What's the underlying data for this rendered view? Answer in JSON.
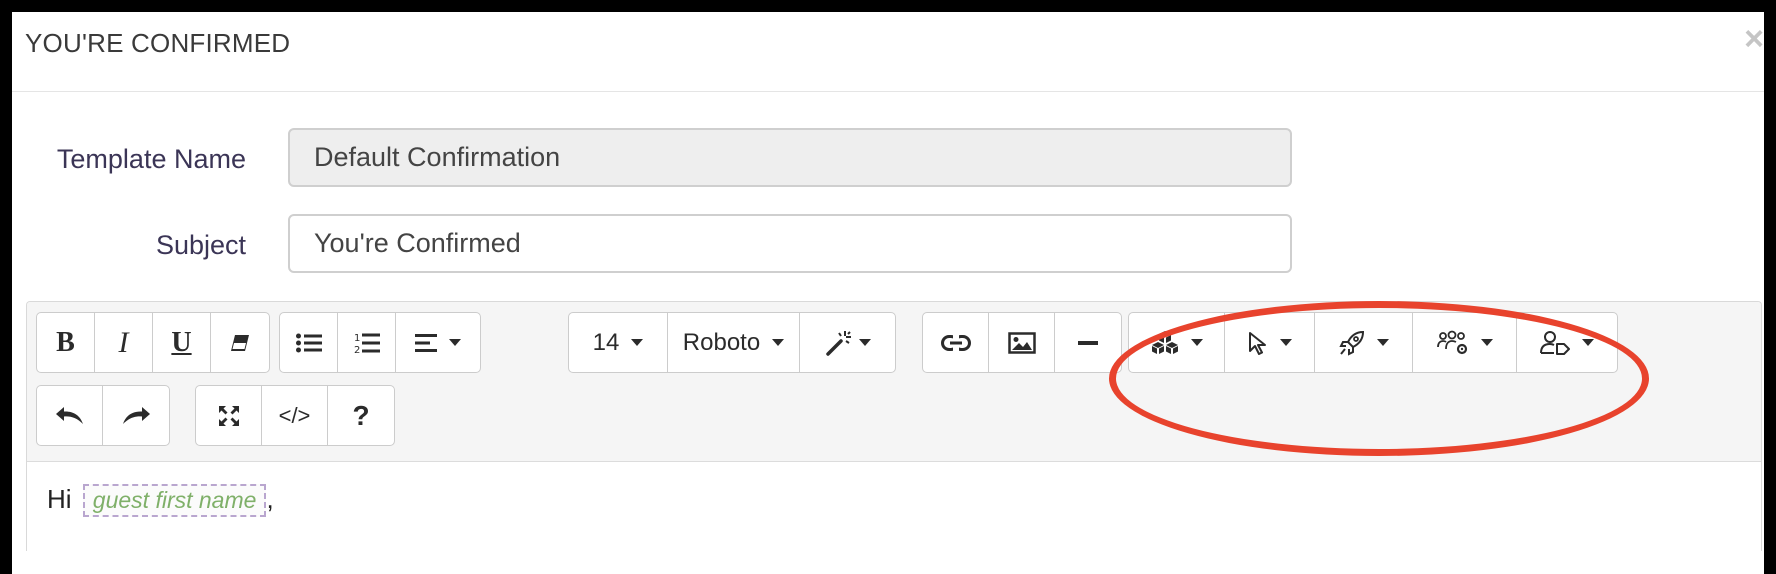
{
  "modal": {
    "title": "YOU'RE CONFIRMED",
    "close_label": "×"
  },
  "form": {
    "template_name_label": "Template Name",
    "template_name_value": "Default Confirmation",
    "subject_label": "Subject",
    "subject_value": "You're Confirmed"
  },
  "toolbar": {
    "font_size": "14",
    "font_family": "Roboto",
    "code_view_label": "</>",
    "help_label": "?"
  },
  "content": {
    "greeting": "Hi",
    "merge_tag": "guest first name",
    "punctuation": ","
  },
  "colors": {
    "highlight": "#e8432d",
    "merge_tag_text": "#7fb069",
    "merge_tag_border": "#b9a6cf"
  },
  "icons": {
    "bold": "bold-icon",
    "italic": "italic-icon",
    "underline": "underline-icon",
    "eraser": "eraser-icon",
    "bullet_list": "bullet-list-icon",
    "numbered_list": "numbered-list-icon",
    "align": "align-left-icon",
    "magic": "magic-wand-icon",
    "link": "link-icon",
    "image": "image-icon",
    "hr": "horizontal-rule-icon",
    "cubes": "cubes-icon",
    "pointer": "cursor-pointer-icon",
    "rocket": "rocket-icon",
    "users_gear": "users-gear-icon",
    "user_tag": "user-tag-icon",
    "undo": "undo-icon",
    "redo": "redo-icon",
    "fullscreen": "fullscreen-icon"
  }
}
